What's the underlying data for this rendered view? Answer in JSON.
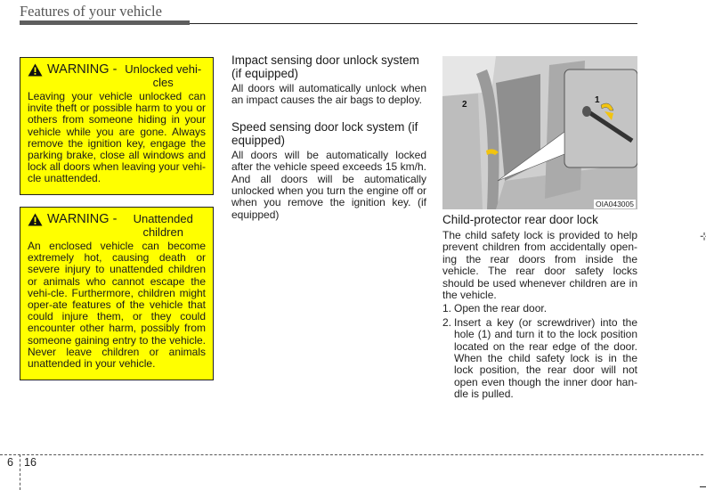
{
  "header": {
    "title": "Features of your vehicle"
  },
  "warnings": [
    {
      "word": "WARNING -",
      "subject": "Unlocked vehi-cles",
      "body": "Leaving your vehicle unlocked can invite theft or possible harm to you or others from someone hiding in your vehicle while you are gone. Always remove the ignition key, engage the parking brake, close all windows and lock all doors when leaving your vehi-cle unattended.",
      "icon": "warning-triangle-icon"
    },
    {
      "word": "WARNING -",
      "subject": "Unattended children",
      "body": "An enclosed vehicle can become extremely hot, causing death or severe injury to unattended children or animals who cannot escape the vehi-cle. Furthermore, children might oper-ate features of the vehicle that could injure them, or they could encounter other harm, possibly from someone gaining entry to the vehicle. Never leave children or animals unattended in your vehicle.",
      "icon": "warning-triangle-icon"
    }
  ],
  "sections": [
    {
      "title": "Impact sensing door unlock system (if equipped)",
      "body": "All doors will automatically unlock when an impact causes the air bags to deploy."
    },
    {
      "title": "Speed sensing door lock system (if equipped)",
      "body": "All doors will be automatically locked after the vehicle speed exceeds 15 km/h. And all doors will be automatically unlocked when you turn the engine off or when you remove the ignition key. (if equipped)"
    }
  ],
  "figure": {
    "code": "OIA043005",
    "label_1": "1",
    "label_2": "2"
  },
  "child_lock": {
    "title": "Child-protector rear door lock",
    "intro": "The child safety lock is provided to help prevent children from accidentally open-ing the rear doors from inside the vehicle. The rear door safety locks should be used whenever children are in the vehicle.",
    "steps": [
      {
        "num": "1.",
        "text": "Open the rear door."
      },
      {
        "num": "2.",
        "text": "Insert a key (or screwdriver) into the hole (1) and turn it to the lock position located on the rear edge of the door. When the child safety lock is in the lock position, the rear door will not open even though the inner door han-dle is pulled."
      }
    ]
  },
  "footer": {
    "chapter": "6",
    "page": "16"
  },
  "colors": {
    "warning_bg": "#ffff00",
    "header_bar": "#5e5e5e"
  }
}
